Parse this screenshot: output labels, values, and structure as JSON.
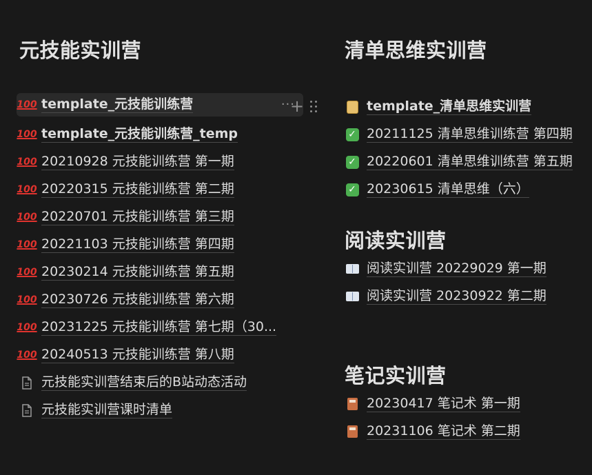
{
  "left": {
    "title": "元技能实训营",
    "items": [
      {
        "icon": "hundred-points-icon",
        "label": "template_元技能训练营",
        "bold": true
      },
      {
        "icon": "hundred-points-icon",
        "label": "template_元技能训练营_temp",
        "bold": true
      },
      {
        "icon": "hundred-points-icon",
        "label": "20210928 元技能训练营 第一期"
      },
      {
        "icon": "hundred-points-icon",
        "label": "20220315 元技能训练营 第二期"
      },
      {
        "icon": "hundred-points-icon",
        "label": "20220701 元技能训练营 第三期"
      },
      {
        "icon": "hundred-points-icon",
        "label": "20221103 元技能训练营 第四期"
      },
      {
        "icon": "hundred-points-icon",
        "label": "20230214 元技能训练营 第五期"
      },
      {
        "icon": "hundred-points-icon",
        "label": "20230726 元技能训练营 第六期"
      },
      {
        "icon": "hundred-points-icon",
        "label": "20231225 元技能训练营 第七期（30..."
      },
      {
        "icon": "hundred-points-icon",
        "label": "20240513 元技能训练营 第八期"
      },
      {
        "icon": "document-icon",
        "label": "元技能实训营结束后的B站动态活动"
      },
      {
        "icon": "document-icon",
        "label": "元技能实训营课时清单"
      }
    ],
    "more_label": "···"
  },
  "toolbar": {
    "plus_label": "+"
  },
  "right": {
    "sections": [
      {
        "title": "清单思维实训营",
        "items": [
          {
            "icon": "scroll-icon",
            "label": "template_清单思维实训营",
            "bold": true
          },
          {
            "icon": "check-mark-icon",
            "label": "20211125 清单思维训练营 第四期"
          },
          {
            "icon": "check-mark-icon",
            "label": "20220601 清单思维训练营 第五期"
          },
          {
            "icon": "check-mark-icon",
            "label": "20230615 清单思维（六）"
          }
        ]
      },
      {
        "title": "阅读实训营",
        "items": [
          {
            "icon": "open-book-icon",
            "label": "阅读实训营 20229029 第一期"
          },
          {
            "icon": "open-book-icon",
            "label": "阅读实训营 20230922 第二期"
          }
        ]
      },
      {
        "title": "笔记实训营",
        "items": [
          {
            "icon": "notebook-icon",
            "label": "20230417 笔记术 第一期"
          },
          {
            "icon": "notebook-icon",
            "label": "20231106 笔记术 第二期"
          }
        ]
      }
    ]
  },
  "colors": {
    "background": "#191919",
    "hover": "#2a2a2a",
    "text": "#dcdcdc"
  }
}
